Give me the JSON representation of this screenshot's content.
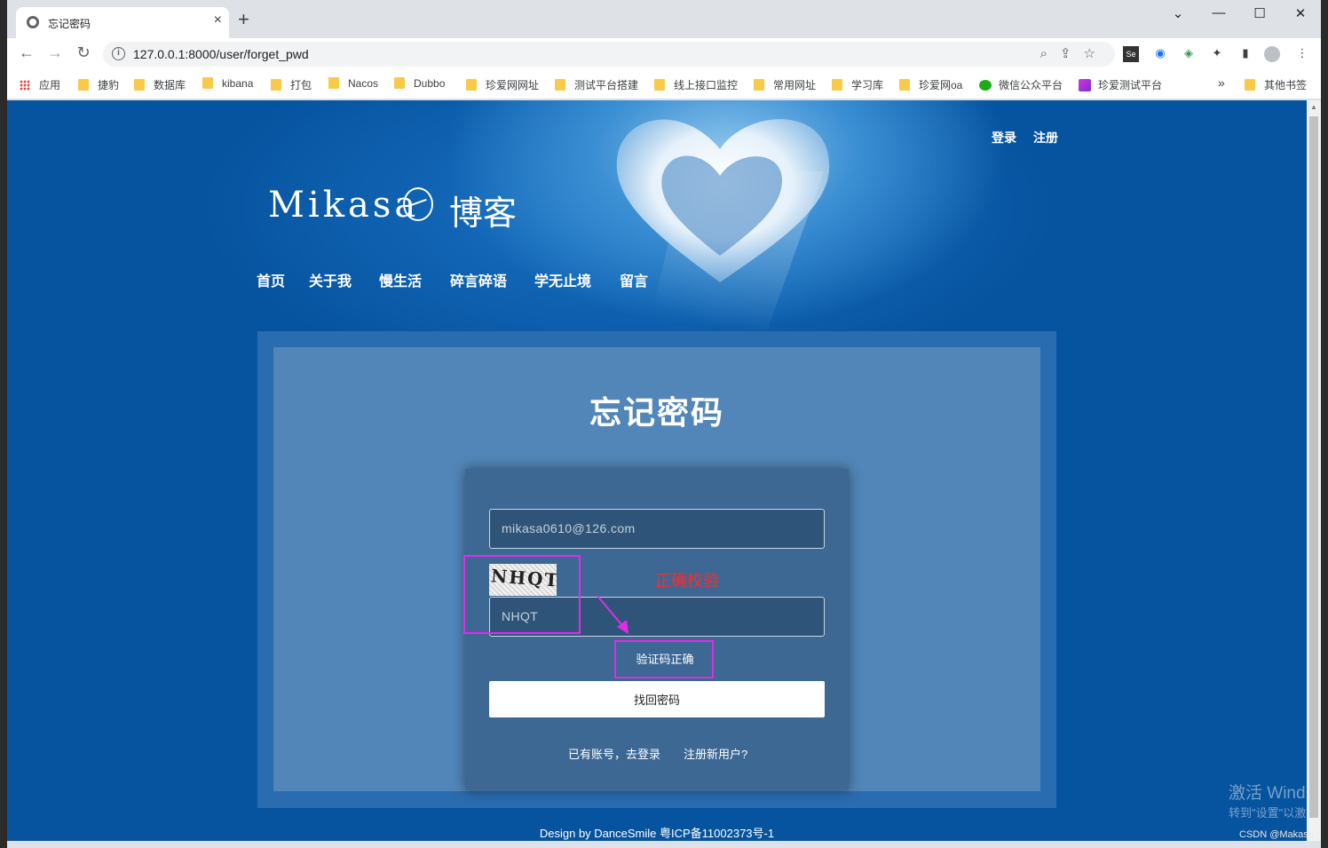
{
  "browser": {
    "tab_title": "忘记密码",
    "url": "127.0.0.1:8000/user/forget_pwd",
    "bookmarks": [
      "应用",
      "捷豹",
      "数据库",
      "kibana",
      "打包",
      "Nacos",
      "Dubbo",
      "珍爱网网址",
      "测试平台搭建",
      "线上接口监控",
      "常用网址",
      "学习库",
      "珍爱网oa",
      "微信公众平台",
      "珍爱测试平台"
    ],
    "bookmarks_more": "»",
    "other_bookmarks": "其他书签"
  },
  "site": {
    "top_links": [
      "登录",
      "注册"
    ],
    "brand": "Mikasa",
    "brand_cn": "博客",
    "nav": [
      "首页",
      "关于我",
      "慢生活",
      "碎言碎语",
      "学无止境",
      "留言"
    ]
  },
  "form": {
    "heading": "忘记密码",
    "email_value": "mikasa0610@126.com",
    "captcha_image_text": "NHQT",
    "captcha_value": "NHQT",
    "verify_message": "验证码正确",
    "submit_label": "找回密码",
    "login_link": "已有账号，去登录",
    "register_link": "注册新用户?"
  },
  "annotation": {
    "label": "正确校验",
    "color": "#e02ce8"
  },
  "footer": "Design by DanceSmile 粤ICP备11002373号-1",
  "overlay": {
    "watermark_line1": "激活 Wind",
    "watermark_line2": "转到\"设置\"以激",
    "csdn": "CSDN @Makasa"
  }
}
